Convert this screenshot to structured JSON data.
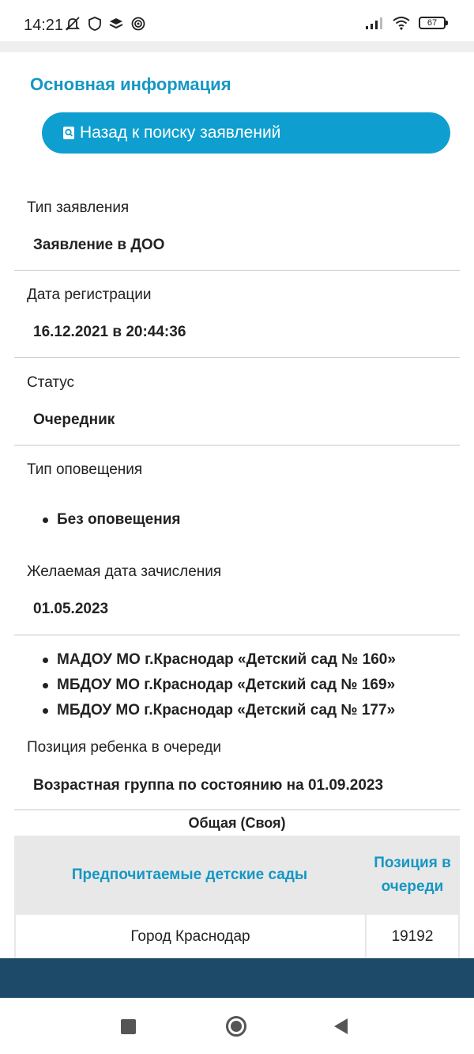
{
  "status_bar": {
    "time": "14:21",
    "battery": "67",
    "icons": [
      "notifications-off-icon",
      "shield-icon",
      "layers-icon",
      "target-icon",
      "signal-icon",
      "wifi-icon",
      "battery-icon"
    ]
  },
  "section_title": "Основная информация",
  "back_button": {
    "label": "Назад к поиску заявлений",
    "icon": "search-document-icon"
  },
  "fields": {
    "application_type": {
      "label": "Тип заявления",
      "value": "Заявление в ДОО"
    },
    "registration_date": {
      "label": "Дата регистрации",
      "value": "16.12.2021 в 20:44:36"
    },
    "status": {
      "label": "Статус",
      "value": "Очередник"
    },
    "notification_type": {
      "label": "Тип оповещения",
      "items": [
        "Без оповещения"
      ]
    },
    "desired_enrollment_date": {
      "label": "Желаемая дата зачисления",
      "value": "01.05.2023"
    }
  },
  "kindergartens": [
    "МАДОУ МО г.Краснодар «Детский сад № 160»",
    "МБДОУ МО г.Краснодар «Детский сад № 169»",
    "МБДОУ МО г.Краснодар «Детский сад № 177»"
  ],
  "queue": {
    "label": "Позиция ребенка в очереди",
    "age_group": "Возрастная группа по состоянию на 01.09.2023",
    "table_caption": "Общая (Своя)",
    "columns": [
      "Предпочитаемые детские сады",
      "Позиция в очереди"
    ],
    "rows": [
      {
        "area": "Город Краснодар",
        "position": "19192"
      }
    ]
  },
  "colors": {
    "accent": "#1597c3",
    "button": "#0e9fd0",
    "footer": "#1d4a68"
  }
}
